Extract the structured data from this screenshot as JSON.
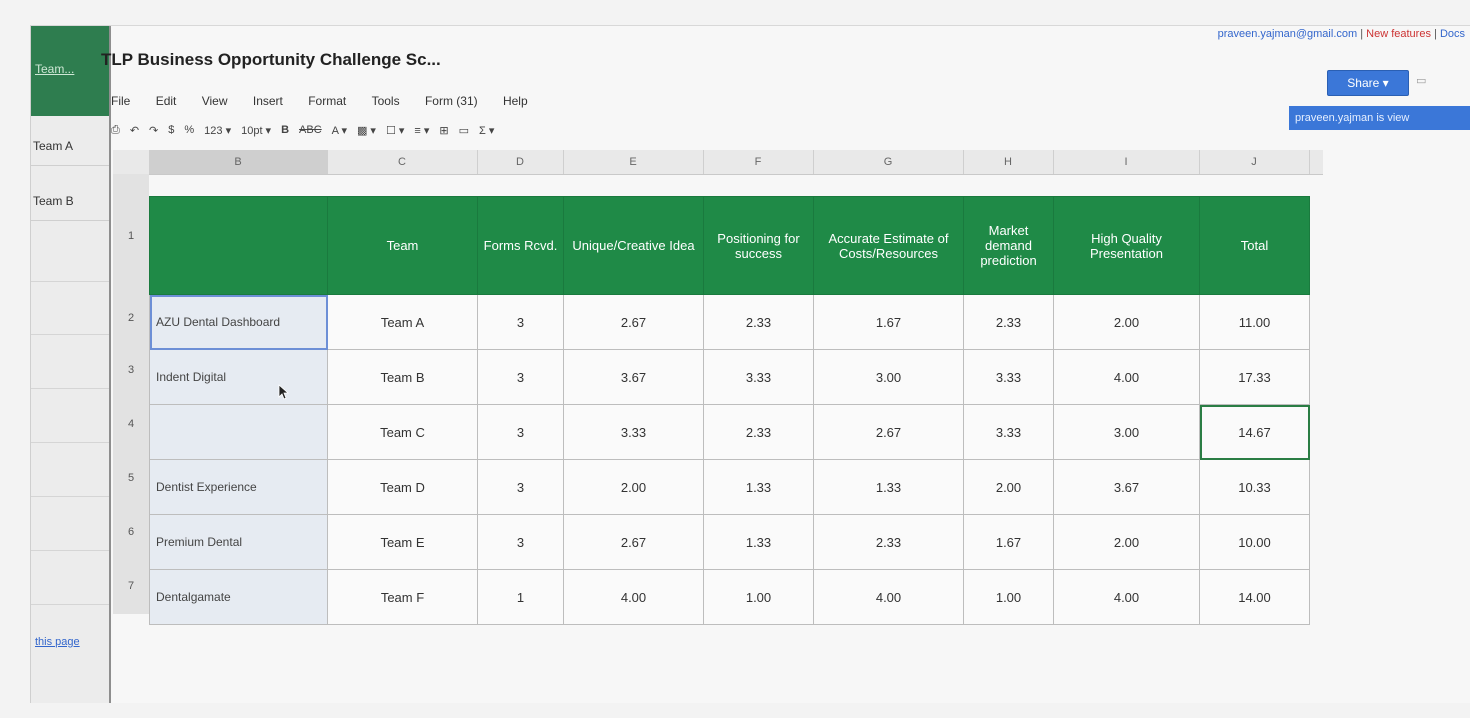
{
  "left_panel": {
    "top_link": "Team...",
    "teams": [
      "Team A",
      "Team B"
    ],
    "bottom_link": "this page"
  },
  "doc": {
    "title": "TLP Business Opportunity Challenge Sc...",
    "user_email": "praveen.yajman@gmail.com",
    "new_features": "New features",
    "docs_link": "Docs",
    "share_label": "Share ▾",
    "viewing_banner": "praveen.yajman is view"
  },
  "menu": [
    "File",
    "Edit",
    "View",
    "Insert",
    "Format",
    "Tools",
    "Form (31)",
    "Help"
  ],
  "toolbar": [
    "⎙",
    "↶",
    "↷",
    "$",
    "%",
    "123 ▾",
    "10pt ▾",
    "B",
    "ABC",
    "A ▾",
    "▩ ▾",
    "☐ ▾",
    "≡ ▾",
    "⊞",
    "▭",
    "Σ ▾"
  ],
  "column_letters": [
    "B",
    "C",
    "D",
    "E",
    "F",
    "G",
    "H",
    "I",
    "J"
  ],
  "row_numbers": [
    "1",
    "2",
    "3",
    "4",
    "5",
    "6",
    "7"
  ],
  "table": {
    "headers": [
      "",
      "Team",
      "Forms Rcvd.",
      "Unique/Creative Idea",
      "Positioning for success",
      "Accurate Estimate of Costs/Resources",
      "Market demand prediction",
      "High Quality Presentation",
      "Total"
    ],
    "rows": [
      [
        "AZU Dental Dashboard",
        "Team A",
        "3",
        "2.67",
        "2.33",
        "1.67",
        "2.33",
        "2.00",
        "11.00"
      ],
      [
        "Indent Digital",
        "Team B",
        "3",
        "3.67",
        "3.33",
        "3.00",
        "3.33",
        "4.00",
        "17.33"
      ],
      [
        "",
        "Team C",
        "3",
        "3.33",
        "2.33",
        "2.67",
        "3.33",
        "3.00",
        "14.67"
      ],
      [
        "Dentist Experience",
        "Team D",
        "3",
        "2.00",
        "1.33",
        "1.33",
        "2.00",
        "3.67",
        "10.33"
      ],
      [
        "Premium Dental",
        "Team E",
        "3",
        "2.67",
        "1.33",
        "2.33",
        "1.67",
        "2.00",
        "10.00"
      ],
      [
        "Dentalgamate",
        "Team F",
        "1",
        "4.00",
        "1.00",
        "4.00",
        "1.00",
        "4.00",
        "14.00"
      ]
    ]
  }
}
